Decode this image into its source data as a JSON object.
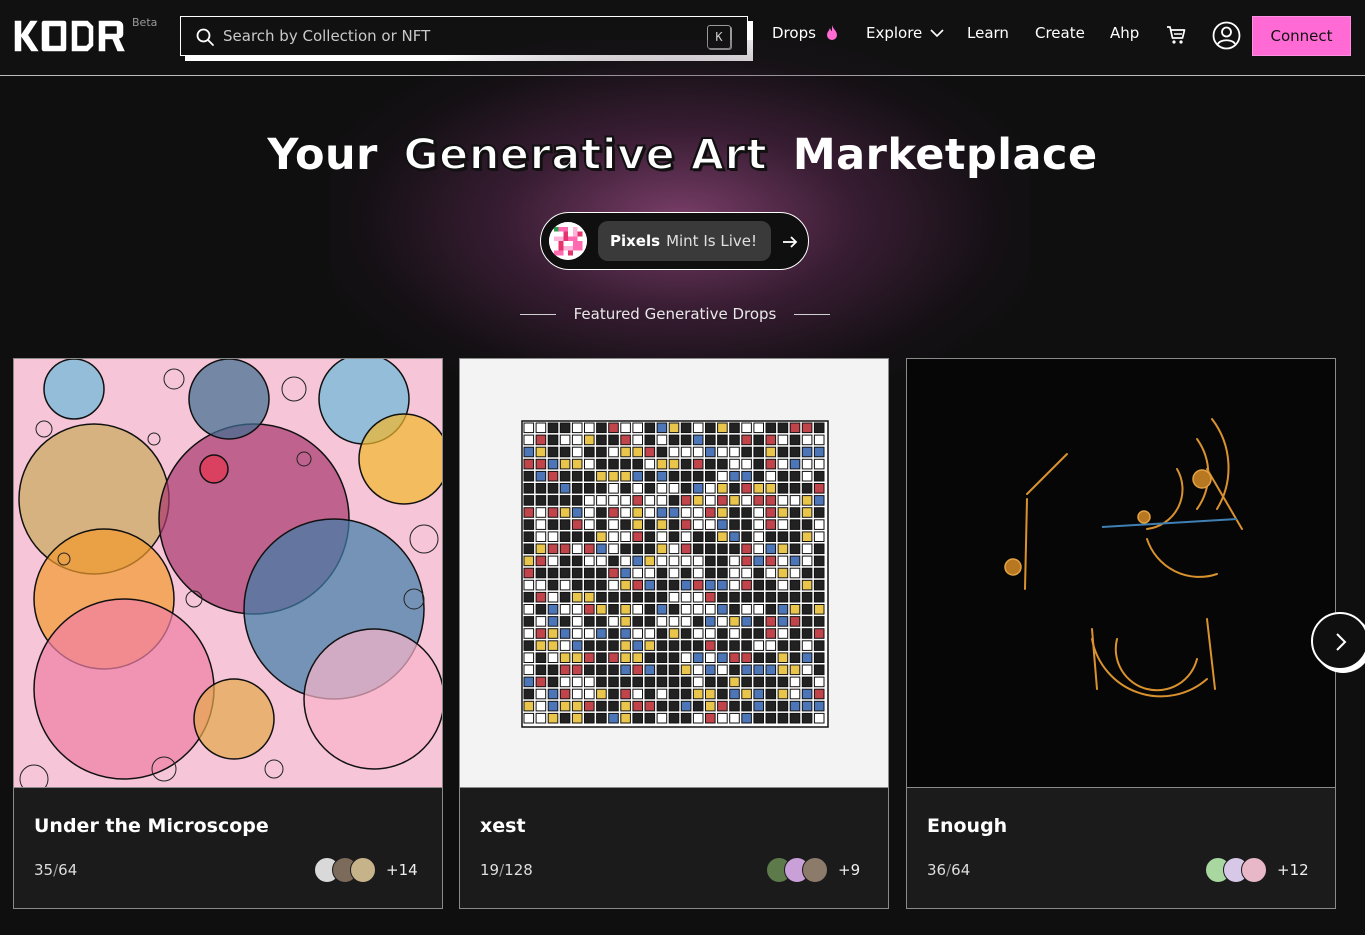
{
  "header": {
    "beta_label": "Beta",
    "search": {
      "placeholder": "Search by Collection or NFT",
      "shortcut_key": "K"
    },
    "nav": [
      {
        "id": "drops",
        "label": "Drops"
      },
      {
        "id": "explore",
        "label": "Explore"
      },
      {
        "id": "learn",
        "label": "Learn"
      },
      {
        "id": "create",
        "label": "Create"
      },
      {
        "id": "ahp",
        "label": "Ahp"
      }
    ],
    "icons": [
      "kodr-logo",
      "search-icon",
      "flame-icon",
      "chevron-down-icon",
      "cart-icon",
      "user-account-icon"
    ],
    "connect_label": "Connect",
    "accent_color": "#ff6ad5"
  },
  "hero": {
    "title_before": "Your",
    "title_highlight": "Generative Art",
    "title_after": "Marketplace",
    "announcement": {
      "name": "Pixels",
      "text": "Mint Is Live!"
    },
    "featured_label": "Featured Generative Drops"
  },
  "cards": [
    {
      "title": "Under the Microscope",
      "minted": "35",
      "supply": "64",
      "extra_owners": "+14"
    },
    {
      "title": "xest",
      "minted": "19",
      "supply": "128",
      "extra_owners": "+9"
    },
    {
      "title": "Enough",
      "minted": "36",
      "supply": "64",
      "extra_owners": "+12"
    }
  ],
  "carousel": {
    "next_icon": "chevron-right-icon"
  }
}
